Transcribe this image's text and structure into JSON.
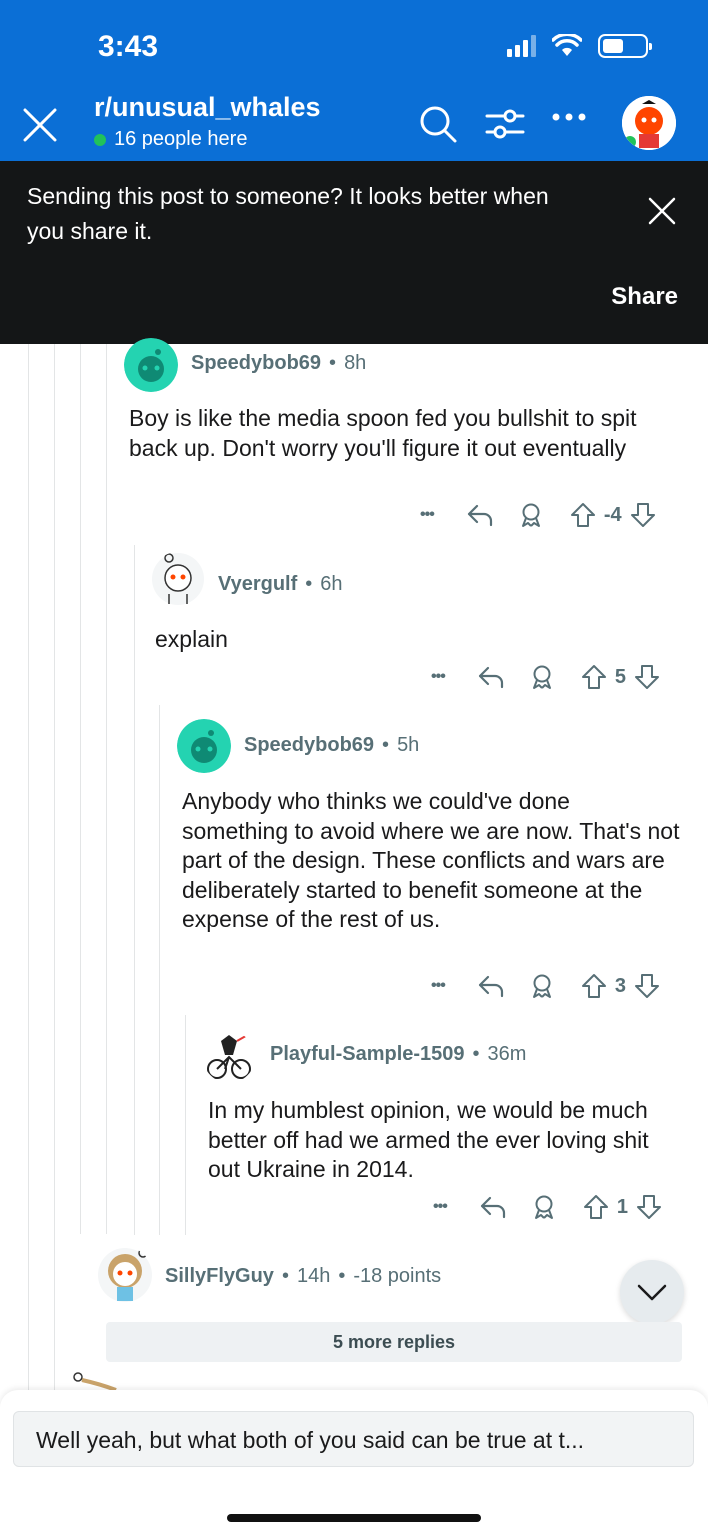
{
  "status_bar": {
    "time": "3:43"
  },
  "header": {
    "subreddit": "r/unusual_whales",
    "online": "16 people here"
  },
  "banner": {
    "text": "Sending this post to someone? It looks better when you share it.",
    "share_label": "Share"
  },
  "comments": [
    {
      "user": "Speedybob69",
      "age": "8h",
      "body": "Boy is like the media spoon fed you bullshit to spit back up. Don't worry you'll figure it out eventually",
      "score": "-4"
    },
    {
      "user": "Vyergulf",
      "age": "6h",
      "body": "explain",
      "score": "5"
    },
    {
      "user": "Speedybob69",
      "age": "5h",
      "body": "Anybody who thinks we could've done something to avoid where we are now. That's not part of the design. These conflicts and wars are deliberately started to benefit someone at the expense of the rest of us.",
      "score": "3"
    },
    {
      "user": "Playful-Sample-1509",
      "age": "36m",
      "body": "In my humblest opinion, we would be much  better off had we armed the ever loving shit out Ukraine in 2014.",
      "score": "1"
    }
  ],
  "collapsed_comment": {
    "user": "SillyFlyGuy",
    "age": "14h",
    "points": "-18 points"
  },
  "more_replies": "5 more replies",
  "composer": {
    "text": "Well yeah, but what both of you said can be true at t..."
  },
  "separator": "•",
  "more_dots": "•••",
  "icons": [
    "close-icon",
    "search-icon",
    "filter-icon",
    "more-icon",
    "reply-icon",
    "award-icon",
    "upvote-icon",
    "downvote-icon",
    "chevron-down-icon"
  ],
  "colors": {
    "header_blue": "#0b6fd6",
    "banner_dark": "#141617",
    "online_green": "#21c25a",
    "meta_gray": "#576f76"
  }
}
